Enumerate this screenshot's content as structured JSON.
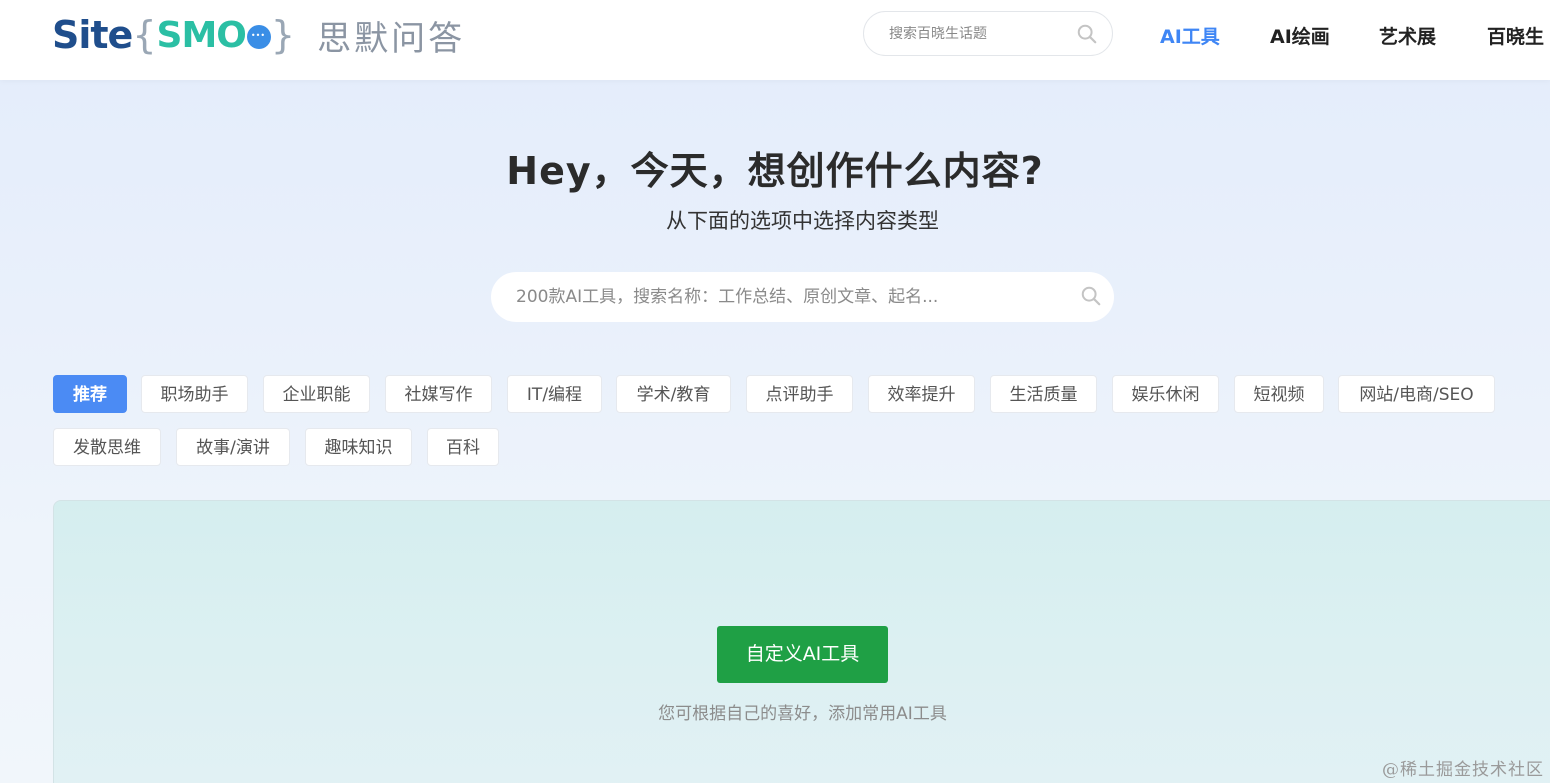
{
  "brand": {
    "logo_site": "Site",
    "logo_smo": "SMO",
    "logo_name": "思默问答"
  },
  "header": {
    "search_placeholder": "搜索百晓生话题",
    "nav": [
      "AI工具",
      "AI绘画",
      "艺术展",
      "百晓生"
    ],
    "active_nav": "AI工具"
  },
  "hero": {
    "title": "Hey，今天，想创作什么内容?",
    "subtitle": "从下面的选项中选择内容类型",
    "search_placeholder": "200款AI工具，搜索名称：工作总结、原创文章、起名..."
  },
  "categories": {
    "active": "推荐",
    "items": [
      "推荐",
      "职场助手",
      "企业职能",
      "社媒写作",
      "IT/编程",
      "学术/教育",
      "点评助手",
      "效率提升",
      "生活质量",
      "娱乐休闲",
      "短视频",
      "网站/电商/SEO",
      "发散思维",
      "故事/演讲",
      "趣味知识",
      "百科"
    ]
  },
  "panel": {
    "button_label": "自定义AI工具",
    "hint": "您可根据自己的喜好，添加常用AI工具"
  },
  "watermark": "@稀土掘金技术社区",
  "colors": {
    "accent": "#4b8bf4",
    "nav_active": "#3f86f5",
    "button_green": "#1fa045",
    "logo_blue": "#1f4e8c",
    "logo_teal": "#2bbfa4"
  },
  "icons": {
    "search": "search-icon",
    "chat": "chat-bubble-icon"
  }
}
